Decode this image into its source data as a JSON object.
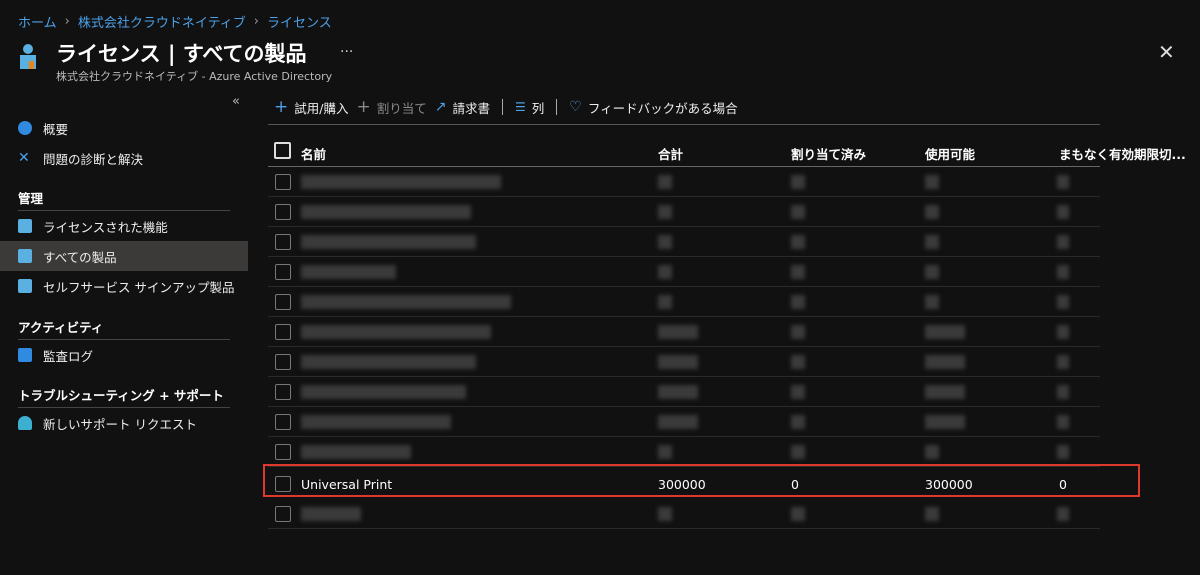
{
  "breadcrumb": [
    "ホーム",
    "株式会社クラウドネイティブ",
    "ライセンス"
  ],
  "header": {
    "title": "ライセンス | すべての製品",
    "subtitle": "株式会社クラウドネイティブ - Azure Active Directory",
    "more": "...",
    "close": "✕"
  },
  "sidebar": {
    "collapse": "«",
    "items": [
      {
        "label": "概要",
        "icon": "info-icon"
      },
      {
        "label": "問題の診断と解決",
        "icon": "wrench-icon"
      }
    ],
    "sections": [
      {
        "title": "管理",
        "items": [
          {
            "label": "ライセンスされた機能"
          },
          {
            "label": "すべての製品",
            "selected": true
          },
          {
            "label": "セルフサービス サインアップ製品"
          }
        ]
      },
      {
        "title": "アクティビティ",
        "items": [
          {
            "label": "監査ログ"
          }
        ]
      },
      {
        "title": "トラブルシューティング + サポート",
        "items": [
          {
            "label": "新しいサポート リクエスト"
          }
        ]
      }
    ]
  },
  "toolbar": {
    "try_buy": "試用/購入",
    "assign": "割り当て",
    "invoice": "請求書",
    "columns": "列",
    "feedback": "フィードバックがある場合"
  },
  "table": {
    "headers": [
      "名前",
      "合計",
      "割り当て済み",
      "使用可能",
      "まもなく有効期限切..."
    ],
    "highlight_row": {
      "name": "Universal Print",
      "total": "300000",
      "assigned": "0",
      "available": "300000",
      "expiring": "0"
    }
  },
  "colors": {
    "accent": "#4ba0e8",
    "highlight": "#e0382c"
  }
}
